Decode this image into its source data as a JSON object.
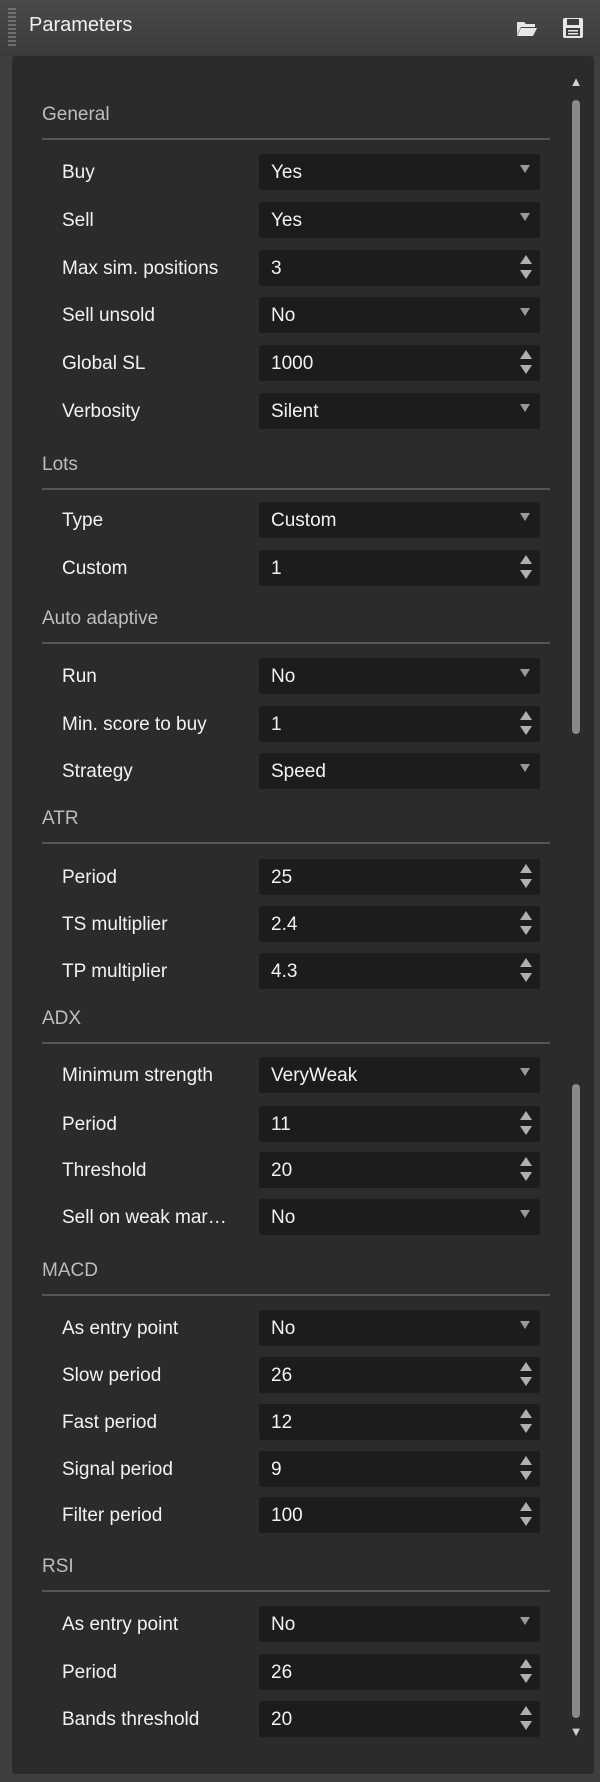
{
  "window": {
    "title": "Parameters",
    "icons": [
      "open-folder-icon",
      "save-icon"
    ]
  },
  "groups": [
    {
      "title": "General",
      "rows": [
        {
          "label": "Buy",
          "value": "Yes",
          "control": "dropdown"
        },
        {
          "label": "Sell",
          "value": "Yes",
          "control": "dropdown"
        },
        {
          "label": "Max sim. positions",
          "value": "3",
          "control": "spinner"
        },
        {
          "label": "Sell unsold",
          "value": "No",
          "control": "dropdown"
        },
        {
          "label": "Global SL",
          "value": "1000",
          "control": "spinner"
        },
        {
          "label": "Verbosity",
          "value": "Silent",
          "control": "dropdown"
        }
      ]
    },
    {
      "title": "Lots",
      "rows": [
        {
          "label": "Type",
          "value": "Custom",
          "control": "dropdown"
        },
        {
          "label": "Custom",
          "value": "1",
          "control": "spinner"
        }
      ]
    },
    {
      "title": "Auto adaptive",
      "rows": [
        {
          "label": "Run",
          "value": "No",
          "control": "dropdown"
        },
        {
          "label": "Min. score to buy",
          "value": "1",
          "control": "spinner"
        },
        {
          "label": "Strategy",
          "value": "Speed",
          "control": "dropdown"
        }
      ]
    },
    {
      "title": "ATR",
      "rows": [
        {
          "label": "Period",
          "value": "25",
          "control": "spinner"
        },
        {
          "label": "TS multiplier",
          "value": "2.4",
          "control": "spinner"
        },
        {
          "label": "TP multiplier",
          "value": "4.3",
          "control": "spinner"
        }
      ]
    },
    {
      "title": "ADX",
      "rows": [
        {
          "label": "Minimum strength",
          "value": "VeryWeak",
          "control": "dropdown"
        },
        {
          "label": "Period",
          "value": "11",
          "control": "spinner"
        },
        {
          "label": "Threshold",
          "value": "20",
          "control": "spinner"
        },
        {
          "label": "Sell on weak mar…",
          "value": "No",
          "control": "dropdown"
        }
      ]
    },
    {
      "title": "MACD",
      "rows": [
        {
          "label": "As entry point",
          "value": "No",
          "control": "dropdown"
        },
        {
          "label": "Slow period",
          "value": "26",
          "control": "spinner"
        },
        {
          "label": "Fast period",
          "value": "12",
          "control": "spinner"
        },
        {
          "label": "Signal period",
          "value": "9",
          "control": "spinner"
        },
        {
          "label": "Filter period",
          "value": "100",
          "control": "spinner"
        }
      ]
    },
    {
      "title": "RSI",
      "rows": [
        {
          "label": "As entry point",
          "value": "No",
          "control": "dropdown"
        },
        {
          "label": "Period",
          "value": "26",
          "control": "spinner"
        },
        {
          "label": "Bands threshold",
          "value": "20",
          "control": "spinner"
        }
      ]
    }
  ]
}
